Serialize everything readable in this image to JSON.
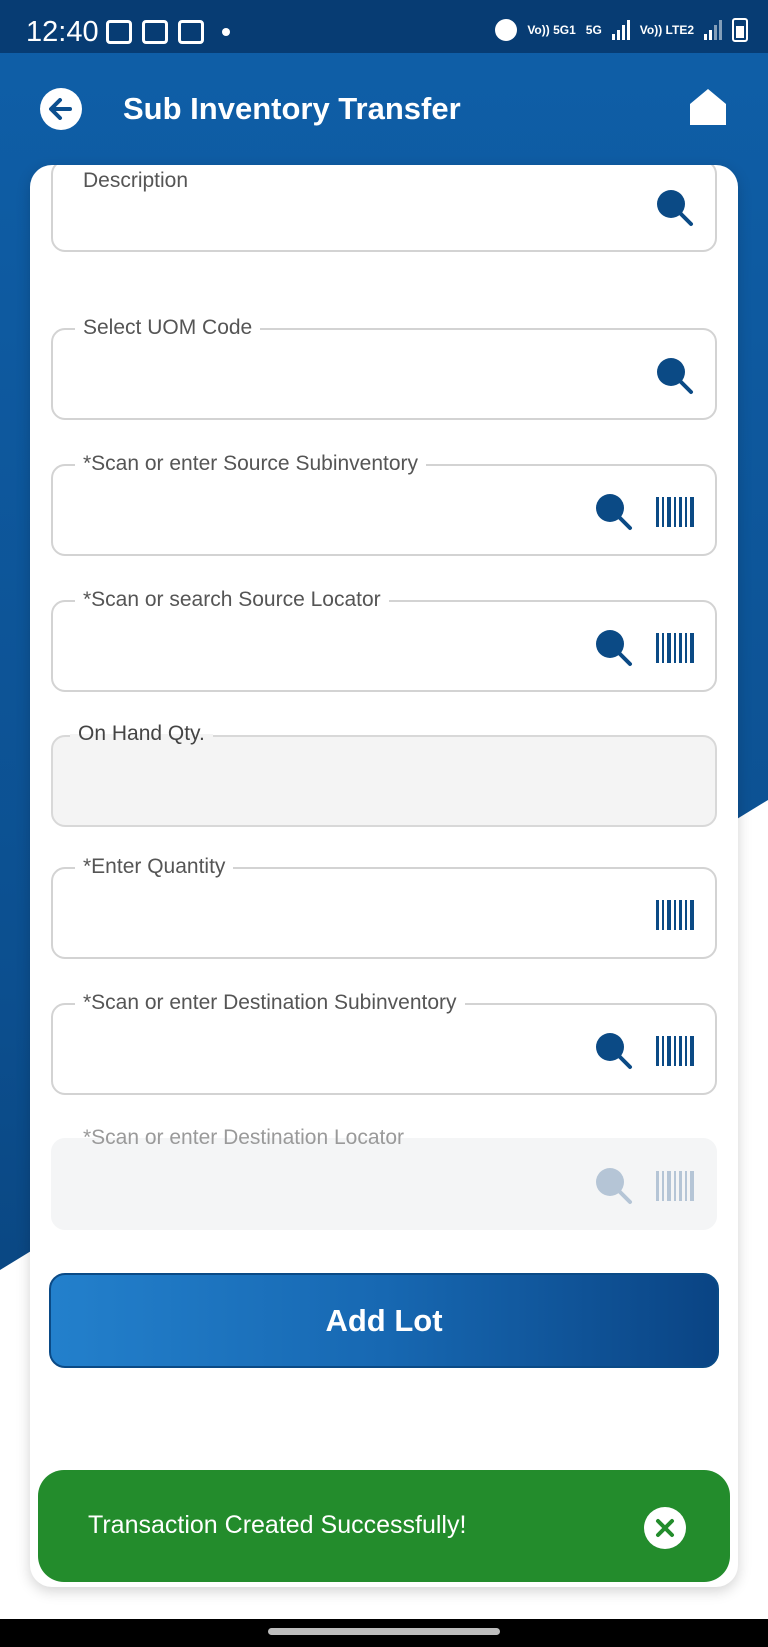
{
  "status_bar": {
    "time": "12:40",
    "net1": "Vo)) 5G1",
    "net2": "5G",
    "net3": "Vo)) LTE2"
  },
  "header": {
    "title": "Sub Inventory Transfer",
    "back_icon": "arrow-left-icon",
    "home_icon": "home-icon"
  },
  "form": {
    "fields": [
      {
        "label": "Description",
        "value": "",
        "icons": [
          "search"
        ]
      },
      {
        "label": "Select UOM Code",
        "value": "",
        "icons": [
          "search"
        ]
      },
      {
        "label": "*Scan or enter Source Subinventory",
        "value": "",
        "icons": [
          "search",
          "barcode"
        ]
      },
      {
        "label": "*Scan or search Source Locator",
        "value": "",
        "icons": [
          "search",
          "barcode"
        ]
      },
      {
        "label": "On Hand Qty.",
        "value": "",
        "icons": []
      },
      {
        "label": "*Enter Quantity",
        "value": "",
        "icons": [
          "barcode"
        ]
      },
      {
        "label": "*Scan or enter Destination Subinventory",
        "value": "",
        "icons": [
          "search",
          "barcode"
        ]
      },
      {
        "label": "*Scan or enter Destination Locator",
        "value": "",
        "icons": [
          "search",
          "barcode"
        ]
      }
    ],
    "add_lot_label": "Add Lot"
  },
  "toast": {
    "message": "Transaction Created Successfully!"
  },
  "colors": {
    "brand_blue": "#0c4f8f",
    "icon_blue": "#0b4a85",
    "success_green": "#238c2c"
  }
}
